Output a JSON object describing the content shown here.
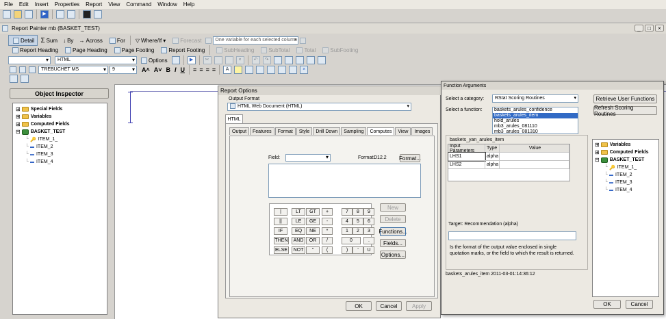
{
  "menubar": [
    "File",
    "Edit",
    "Insert",
    "Properties",
    "Report",
    "View",
    "Command",
    "Window",
    "Help"
  ],
  "painter": {
    "title": "Report Painter mb (BASKET_TEST)",
    "toolbar1": {
      "detail": "Detail",
      "sum": "Sum",
      "by": "By",
      "across": "Across",
      "for": "For",
      "where_if": "Where/If",
      "forecast": "Forecast",
      "combo": "One variable for each selected column"
    },
    "toolbar2": {
      "report_heading": "Report Heading",
      "page_heading": "Page Heading",
      "page_footing": "Page Footing",
      "report_footing": "Report Footing",
      "subheading": "SubHeading",
      "subtotal": "SubTotal",
      "total": "Total",
      "subfooting": "SubFooting"
    },
    "toolbar3": {
      "format": "HTML",
      "options": "Options"
    },
    "toolbar4": {
      "font": "TREBUCHET MS",
      "size": "9"
    }
  },
  "inspector": {
    "title": "Object Inspector",
    "items": [
      {
        "label": "Special Fields",
        "type": "folder",
        "bold": true,
        "level": 0
      },
      {
        "label": "Variables",
        "type": "folder",
        "bold": true,
        "level": 0
      },
      {
        "label": "Computed Fields",
        "type": "folder",
        "bold": true,
        "level": 0
      },
      {
        "label": "BASKET_TEST",
        "type": "db",
        "bold": true,
        "level": 0
      },
      {
        "label": "ITEM_1_",
        "type": "key",
        "bold": false,
        "level": 1
      },
      {
        "label": "ITEM_2",
        "type": "field",
        "bold": false,
        "level": 1
      },
      {
        "label": "ITEM_3",
        "type": "field",
        "bold": false,
        "level": 1
      },
      {
        "label": "ITEM_4",
        "type": "field",
        "bold": false,
        "level": 1
      }
    ]
  },
  "report_options": {
    "title": "Report Options",
    "output_format_label": "Output Format",
    "output_format_value": "HTML Web Document (HTML)",
    "outer_tab": "HTML",
    "tabs": [
      "Output",
      "Features",
      "Format",
      "Style",
      "Drill Down",
      "Sampling",
      "Computes",
      "View",
      "Images"
    ],
    "active_tab": "Computes",
    "field_label": "Field:",
    "format_label": "Format:",
    "format_value": "D12.2",
    "format_button": "Format...",
    "calc_keys": [
      [
        "|",
        "LT",
        "GT",
        "+",
        "7",
        "8",
        "9"
      ],
      [
        "||",
        "LE",
        "GE",
        "-",
        "4",
        "5",
        "6"
      ],
      [
        "IF",
        "EQ",
        "NE",
        "*",
        "1",
        "2",
        "3"
      ],
      [
        "THEN",
        "AND",
        "OR",
        "/",
        "0",
        "."
      ],
      [
        "ELSE",
        "NOT",
        "\"",
        "(",
        ")",
        "'",
        "U"
      ]
    ],
    "side_buttons": {
      "new": "New",
      "delete": "Delete",
      "functions": "Functions...",
      "fields": "Fields...",
      "options": "Options..."
    },
    "footer": {
      "ok": "OK",
      "cancel": "Cancel",
      "apply": "Apply"
    }
  },
  "function_arguments": {
    "title": "Function Arguments",
    "category_label": "Select a category:",
    "category_value": "RStat Scoring Routines",
    "function_label": "Select a function:",
    "functions": [
      "baskets_arules_confidence",
      "baskets_arules_item",
      "hold_arules",
      "mb3_arules_081110",
      "mb3_arules_081310"
    ],
    "selected_function": 1,
    "retrieve_button": "Retrieve User Functions",
    "refresh_button": "Refresh Scoring Routines",
    "signature": "baskets_yan_arules_item",
    "columns": [
      "Input Parameters",
      "Type",
      "Value"
    ],
    "params": [
      {
        "name": "LHS1",
        "type": "alpha",
        "value": ""
      },
      {
        "name": "LHS2",
        "type": "alpha",
        "value": ""
      }
    ],
    "target_label": "Target: Recommendation (alpha)",
    "description": "Is the format of the output value enclosed in single quotation marks, or the field to which the result is returned.",
    "status": "baskets_arules_item 2011-03-01:14:36:12",
    "tree": [
      {
        "label": "Variables",
        "type": "folder",
        "level": 0
      },
      {
        "label": "Computed Fields",
        "type": "folder",
        "level": 0
      },
      {
        "label": "BASKET_TEST",
        "type": "db",
        "level": 0
      },
      {
        "label": "ITEM_1_",
        "type": "key",
        "level": 1
      },
      {
        "label": "ITEM_2",
        "type": "field",
        "level": 1
      },
      {
        "label": "ITEM_3",
        "type": "field",
        "level": 1
      },
      {
        "label": "ITEM_4",
        "type": "field",
        "level": 1
      }
    ],
    "ok": "OK",
    "cancel": "Cancel"
  }
}
